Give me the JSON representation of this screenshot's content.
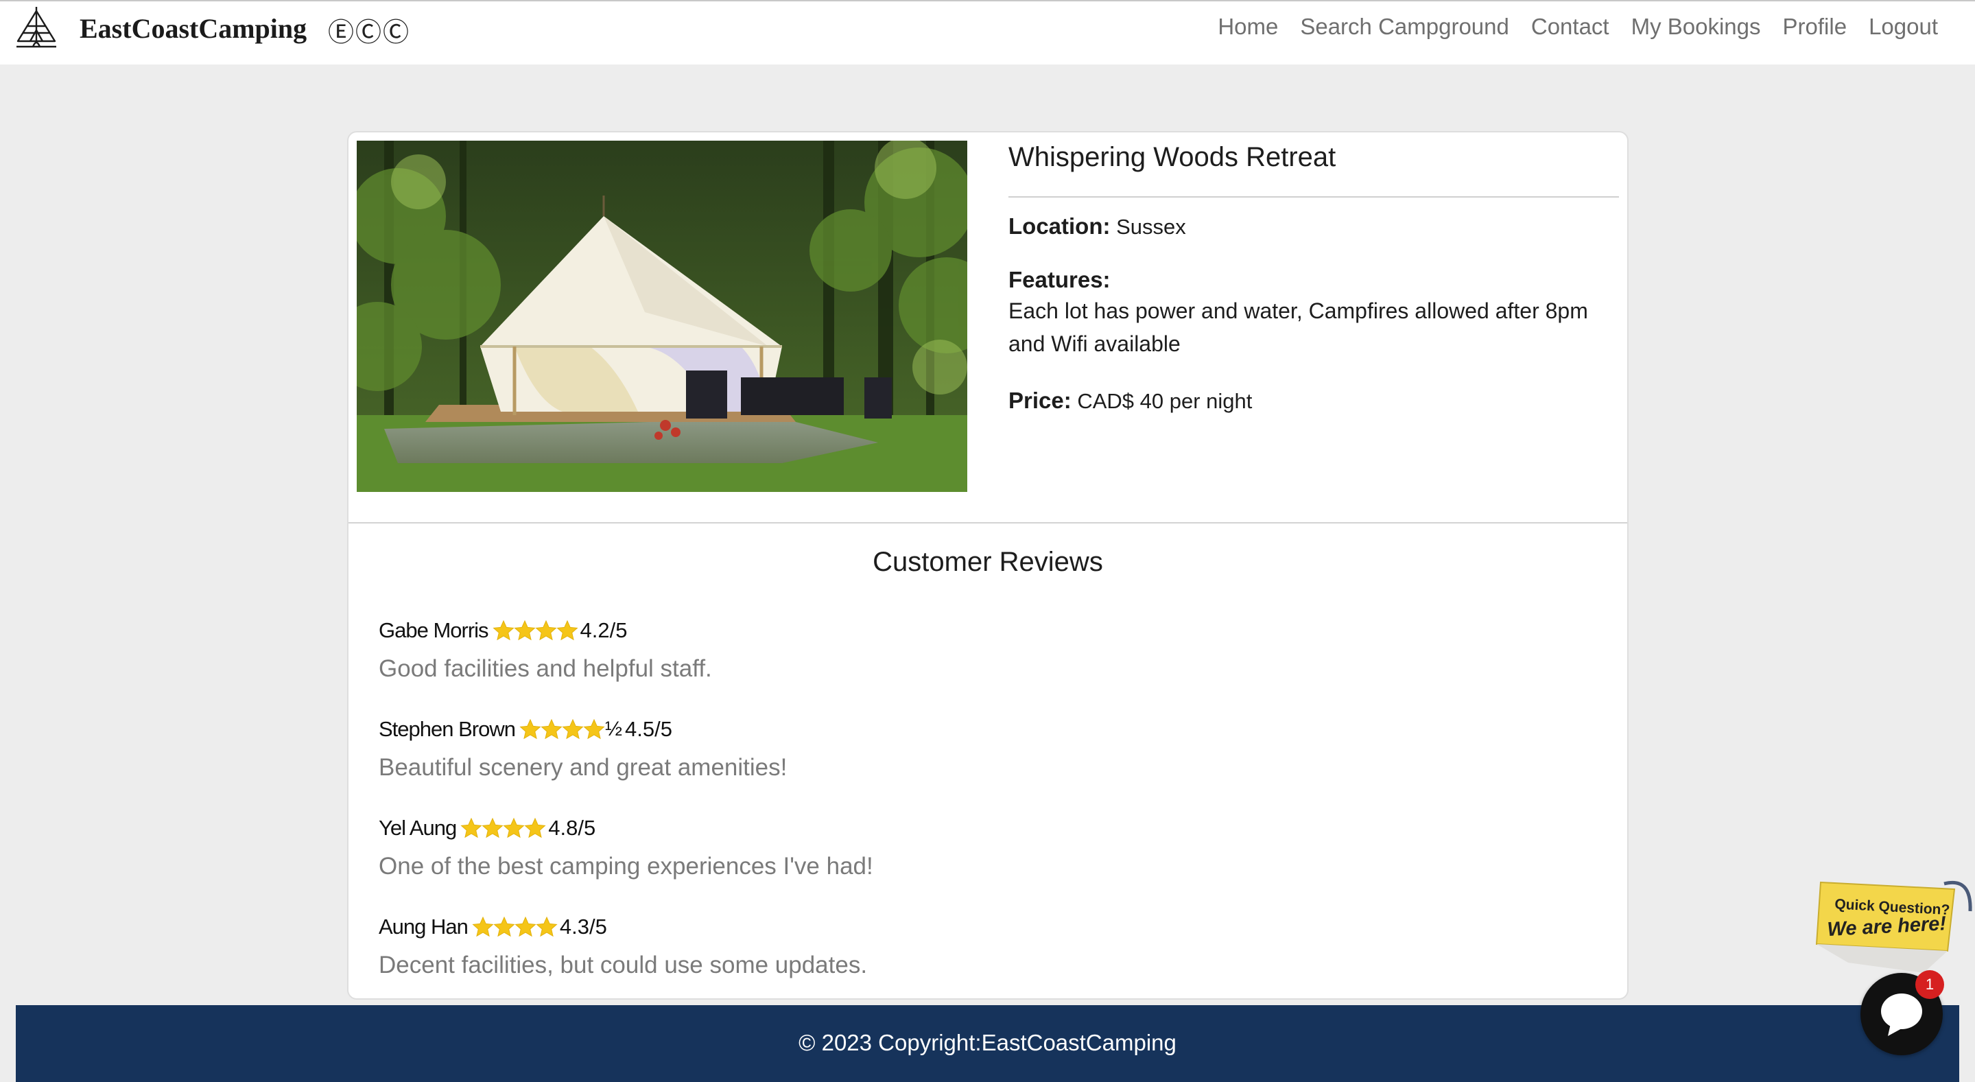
{
  "brand": {
    "name": "EastCoastCamping",
    "marks": "ⒺⒸⒸ",
    "logo_icon": "campfire-tent-logo"
  },
  "nav": {
    "items": [
      {
        "label": "Home"
      },
      {
        "label": "Search Campground"
      },
      {
        "label": "Contact"
      },
      {
        "label": "My Bookings"
      },
      {
        "label": "Profile"
      },
      {
        "label": "Logout"
      }
    ]
  },
  "campground": {
    "title": "Whispering Woods Retreat",
    "location_label": "Location:",
    "location": "Sussex",
    "features_label": "Features:",
    "features": "Each lot has power and water, Campfires allowed after 8pm and Wifi available",
    "price_label": "Price:",
    "price": "CAD$ 40 per night",
    "photo_icon": "bell-tent-photo"
  },
  "reviews": {
    "heading": "Customer Reviews",
    "items": [
      {
        "name": "Gabe Morris",
        "stars": 4,
        "half": "",
        "rating": "4.2/5",
        "text": "Good facilities and helpful staff."
      },
      {
        "name": "Stephen Brown",
        "stars": 4,
        "half": "½",
        "rating": "4.5/5",
        "text": "Beautiful scenery and great amenities!"
      },
      {
        "name": "Yel Aung",
        "stars": 4,
        "half": "",
        "rating": "4.8/5",
        "text": "One of the best camping experiences I've had!"
      },
      {
        "name": "Aung Han",
        "stars": 4,
        "half": "",
        "rating": "4.3/5",
        "text": "Decent facilities, but could use some updates."
      }
    ]
  },
  "footer": {
    "text": "© 2023 Copyright:EastCoastCamping"
  },
  "chat": {
    "promo_line1": "Quick Question?",
    "promo_line2": "We are here!",
    "badge_count": "1",
    "icon": "chat-bubble-icon"
  },
  "colors": {
    "page_bg": "#ededed",
    "footer_bg": "#16335b",
    "star": "#f5c518",
    "muted_text": "#7a7a7a",
    "badge": "#d62020"
  }
}
